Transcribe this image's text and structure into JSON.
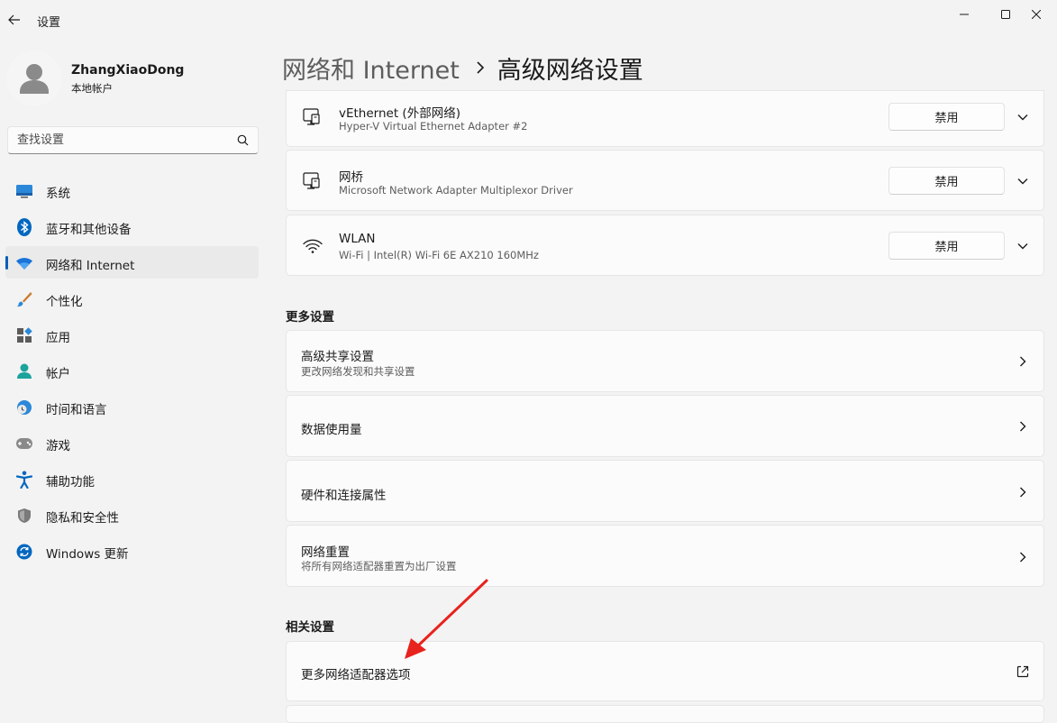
{
  "window": {
    "title": "设置"
  },
  "profile": {
    "name": "ZhangXiaoDong",
    "account_type": "本地帐户"
  },
  "search": {
    "placeholder": "查找设置"
  },
  "nav": {
    "items": [
      {
        "label": "系统",
        "icon": "system-icon"
      },
      {
        "label": "蓝牙和其他设备",
        "icon": "bluetooth-icon"
      },
      {
        "label": "网络和 Internet",
        "icon": "wifi-icon",
        "active": true
      },
      {
        "label": "个性化",
        "icon": "brush-icon"
      },
      {
        "label": "应用",
        "icon": "apps-icon"
      },
      {
        "label": "帐户",
        "icon": "account-icon"
      },
      {
        "label": "时间和语言",
        "icon": "time-language-icon"
      },
      {
        "label": "游戏",
        "icon": "gamepad-icon"
      },
      {
        "label": "辅助功能",
        "icon": "accessibility-icon"
      },
      {
        "label": "隐私和安全性",
        "icon": "shield-icon"
      },
      {
        "label": "Windows 更新",
        "icon": "update-icon"
      }
    ]
  },
  "header": {
    "parent": "网络和 Internet",
    "current": "高级网络设置"
  },
  "adapters": [
    {
      "name": "vEthernet (外部网络)",
      "description": "Hyper-V Virtual Ethernet Adapter #2",
      "button": "禁用",
      "icon": "ethernet-icon"
    },
    {
      "name": "网桥",
      "description": "Microsoft Network Adapter Multiplexor Driver",
      "button": "禁用",
      "icon": "ethernet-icon"
    },
    {
      "name": "WLAN",
      "description": "Wi-Fi | Intel(R) Wi-Fi 6E AX210 160MHz",
      "button": "禁用",
      "icon": "wifi-icon"
    }
  ],
  "more_settings": {
    "title": "更多设置",
    "items": [
      {
        "title": "高级共享设置",
        "subtitle": "更改网络发现和共享设置"
      },
      {
        "title": "数据使用量"
      },
      {
        "title": "硬件和连接属性"
      },
      {
        "title": "网络重置",
        "subtitle": "将所有网络适配器重置为出厂设置"
      }
    ]
  },
  "related_settings": {
    "title": "相关设置",
    "items": [
      {
        "title": "更多网络适配器选项",
        "icon": "external-link-icon"
      }
    ]
  },
  "colors": {
    "accent": "#005fb8",
    "annotation_arrow": "#e8231e"
  }
}
